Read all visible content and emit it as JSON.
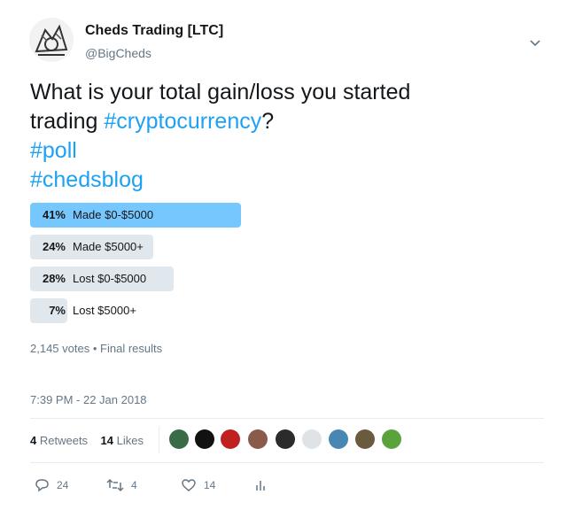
{
  "tweet": {
    "author_name": "Cheds Trading [LTC]",
    "author_handle": "@BigCheds",
    "text_line1": "What is your total gain/loss you started",
    "text_line2_prefix": "trading ",
    "hashtag1": "#cryptocurrency",
    "text_line2_suffix": "?",
    "hashtag2": "#poll",
    "hashtag3": "#chedsblog"
  },
  "poll": {
    "options": [
      {
        "pct": "41%",
        "label": "Made $0-$5000",
        "fraction": 0.41,
        "winner": true
      },
      {
        "pct": "24%",
        "label": "Made $5000+",
        "fraction": 0.24,
        "winner": false
      },
      {
        "pct": "28%",
        "label": "Lost $0-$5000",
        "fraction": 0.28,
        "winner": false
      },
      {
        "pct": "7%",
        "label": "Lost $5000+",
        "fraction": 0.07,
        "winner": false
      }
    ],
    "votes_text": "2,145 votes",
    "separator": "•",
    "status": "Final results"
  },
  "timestamp": "7:39 PM - 22 Jan 2018",
  "stats": {
    "retweets_count": "4",
    "retweets_label": "Retweets",
    "likes_count": "14",
    "likes_label": "Likes"
  },
  "actions": {
    "reply_count": "24",
    "retweet_count": "4",
    "like_count": "14"
  },
  "icons": [
    "avatar",
    "chevron-down-icon",
    "reply-icon",
    "retweet-icon",
    "like-icon",
    "analytics-icon"
  ],
  "colors": {
    "link": "#1da1f2",
    "poll_winner": "#77c7ff",
    "poll_bar": "#e1e8ed",
    "muted": "#657786"
  }
}
